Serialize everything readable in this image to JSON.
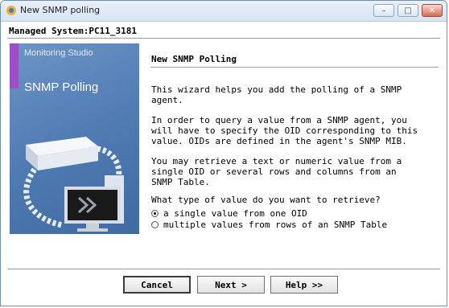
{
  "window": {
    "title": "New SNMP polling",
    "minimize_glyph": "–",
    "maximize_glyph": "□",
    "close_glyph": "✕"
  },
  "managed_system": "Managed System:PC11_3181",
  "banner": {
    "brand": "Monitoring Studio",
    "title": "SNMP Polling"
  },
  "heading": "New SNMP Polling",
  "paragraphs": [
    "This wizard helps you add the polling of a SNMP\nagent.",
    "In order to query a value from a SNMP agent, you\nwill have to specify the OID corresponding to this\nvalue. OIDs are defined in the agent's SNMP MIB.",
    "You may retrieve a text or numeric value from a\nsingle OID or several rows and columns from an\nSNMP Table."
  ],
  "question": "What type of value do you want to retrieve?",
  "options": [
    {
      "label": "a single value from one OID",
      "selected": true
    },
    {
      "label": "multiple values from rows of an SNMP Table",
      "selected": false
    }
  ],
  "buttons": {
    "cancel": "Cancel",
    "next": "Next >",
    "help": "Help >>"
  },
  "colors": {
    "banner_blue": "#4e79b1",
    "banner_accent": "#9a4fc5",
    "title_bar": "#dbe7f4"
  },
  "icons": [
    "app-icon",
    "minimize-icon",
    "maximize-icon",
    "close-icon",
    "server-icon",
    "monitor-icon",
    "arrows-icon"
  ]
}
